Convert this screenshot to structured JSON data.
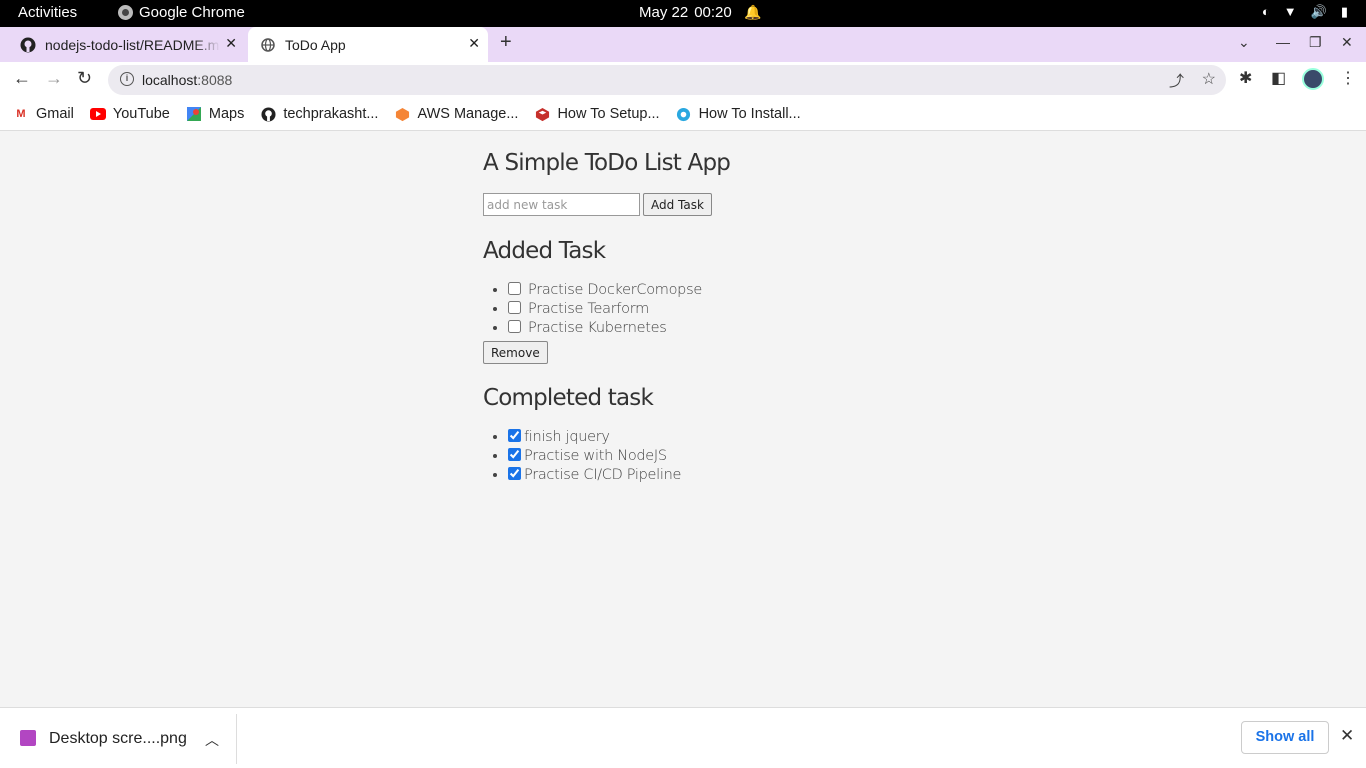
{
  "system": {
    "activities": "Activities",
    "app_name": "Google Chrome",
    "date": "May 22",
    "time": "00:20"
  },
  "tabs": [
    {
      "label": "nodejs-todo-list/README.md",
      "icon": "github-icon"
    },
    {
      "label": "ToDo App",
      "icon": "globe-icon"
    }
  ],
  "address": {
    "host": "localhost",
    "port": ":8088"
  },
  "bookmarks": [
    {
      "label": "Gmail",
      "icon": "gmail-icon",
      "color": "#d93025"
    },
    {
      "label": "YouTube",
      "icon": "youtube-icon",
      "color": "#ff0000"
    },
    {
      "label": "Maps",
      "icon": "maps-icon",
      "color": "#34a853"
    },
    {
      "label": "techprakasht...",
      "icon": "github-icon",
      "color": "#222222"
    },
    {
      "label": "AWS Manage...",
      "icon": "aws-icon",
      "color": "#f58536"
    },
    {
      "label": "How To Setup...",
      "icon": "redis-icon",
      "color": "#c6302b"
    },
    {
      "label": "How To Install...",
      "icon": "site-icon",
      "color": "#29a8e0"
    }
  ],
  "app": {
    "title": "A Simple ToDo List App",
    "input_placeholder": "add new task",
    "add_button": "Add Task",
    "added_heading": "Added Task",
    "added_tasks": [
      "Practise DockerComopse",
      "Practise Tearform",
      "Practise Kubernetes"
    ],
    "remove_button": "Remove",
    "completed_heading": "Completed task",
    "completed_tasks": [
      "finish jquery",
      "Practise with NodeJS",
      "Practise CI/CD Pipeline"
    ]
  },
  "downloads": {
    "file": "Desktop scre....png",
    "show_all": "Show all"
  }
}
